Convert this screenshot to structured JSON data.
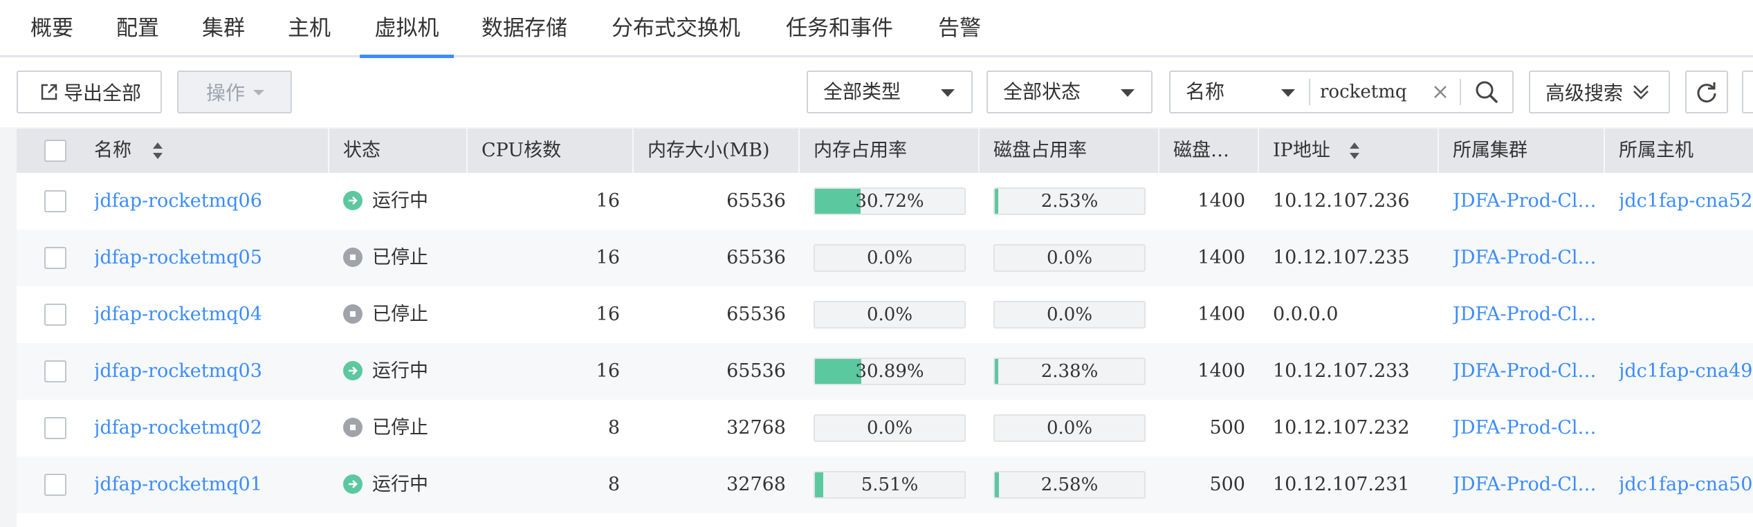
{
  "tabs": [
    "概要",
    "配置",
    "集群",
    "主机",
    "虚拟机",
    "数据存储",
    "分布式交换机",
    "任务和事件",
    "告警"
  ],
  "active_tab_index": 4,
  "toolbar": {
    "export_label": "导出全部",
    "actions_label": "操作",
    "type_filter": "全部类型",
    "status_filter": "全部状态",
    "search_field": "名称",
    "search_value": "rocketmq",
    "advanced_search_label": "高级搜索"
  },
  "table": {
    "headers": {
      "name": "名称",
      "status": "状态",
      "cpu": "CPU核数",
      "memory": "内存大小(MB)",
      "mem_usage": "内存占用率",
      "disk_usage": "磁盘占用率",
      "disk": "磁盘…",
      "ip": "IP地址",
      "cluster": "所属集群",
      "host": "所属主机"
    },
    "rows": [
      {
        "name": "jdfap-rocketmq06",
        "status": "运行中",
        "running": true,
        "cpu": "16",
        "memory": "65536",
        "mem_usage": "30.72%",
        "mem_fill": 0.3072,
        "disk_usage": "2.53%",
        "disk_fill": 0.0253,
        "disk": "1400",
        "ip": "10.12.107.236",
        "cluster": "JDFA-Prod-Cl…",
        "host": "jdc1fap-cna52"
      },
      {
        "name": "jdfap-rocketmq05",
        "status": "已停止",
        "running": false,
        "cpu": "16",
        "memory": "65536",
        "mem_usage": "0.0%",
        "mem_fill": 0,
        "disk_usage": "0.0%",
        "disk_fill": 0,
        "disk": "1400",
        "ip": "10.12.107.235",
        "cluster": "JDFA-Prod-Cl…",
        "host": ""
      },
      {
        "name": "jdfap-rocketmq04",
        "status": "已停止",
        "running": false,
        "cpu": "16",
        "memory": "65536",
        "mem_usage": "0.0%",
        "mem_fill": 0,
        "disk_usage": "0.0%",
        "disk_fill": 0,
        "disk": "1400",
        "ip": "0.0.0.0",
        "cluster": "JDFA-Prod-Cl…",
        "host": ""
      },
      {
        "name": "jdfap-rocketmq03",
        "status": "运行中",
        "running": true,
        "cpu": "16",
        "memory": "65536",
        "mem_usage": "30.89%",
        "mem_fill": 0.3089,
        "disk_usage": "2.38%",
        "disk_fill": 0.0238,
        "disk": "1400",
        "ip": "10.12.107.233",
        "cluster": "JDFA-Prod-Cl…",
        "host": "jdc1fap-cna49"
      },
      {
        "name": "jdfap-rocketmq02",
        "status": "已停止",
        "running": false,
        "cpu": "8",
        "memory": "32768",
        "mem_usage": "0.0%",
        "mem_fill": 0,
        "disk_usage": "0.0%",
        "disk_fill": 0,
        "disk": "500",
        "ip": "10.12.107.232",
        "cluster": "JDFA-Prod-Cl…",
        "host": ""
      },
      {
        "name": "jdfap-rocketmq01",
        "status": "运行中",
        "running": true,
        "cpu": "8",
        "memory": "32768",
        "mem_usage": "5.51%",
        "mem_fill": 0.0551,
        "disk_usage": "2.58%",
        "disk_fill": 0.0258,
        "disk": "500",
        "ip": "10.12.107.231",
        "cluster": "JDFA-Prod-Cl…",
        "host": "jdc1fap-cna50"
      }
    ]
  },
  "colors": {
    "accent": "#3b8cff",
    "running": "#5cc8a0",
    "stopped": "#a0a4aa",
    "usage_bar": "#5cc8a0"
  }
}
